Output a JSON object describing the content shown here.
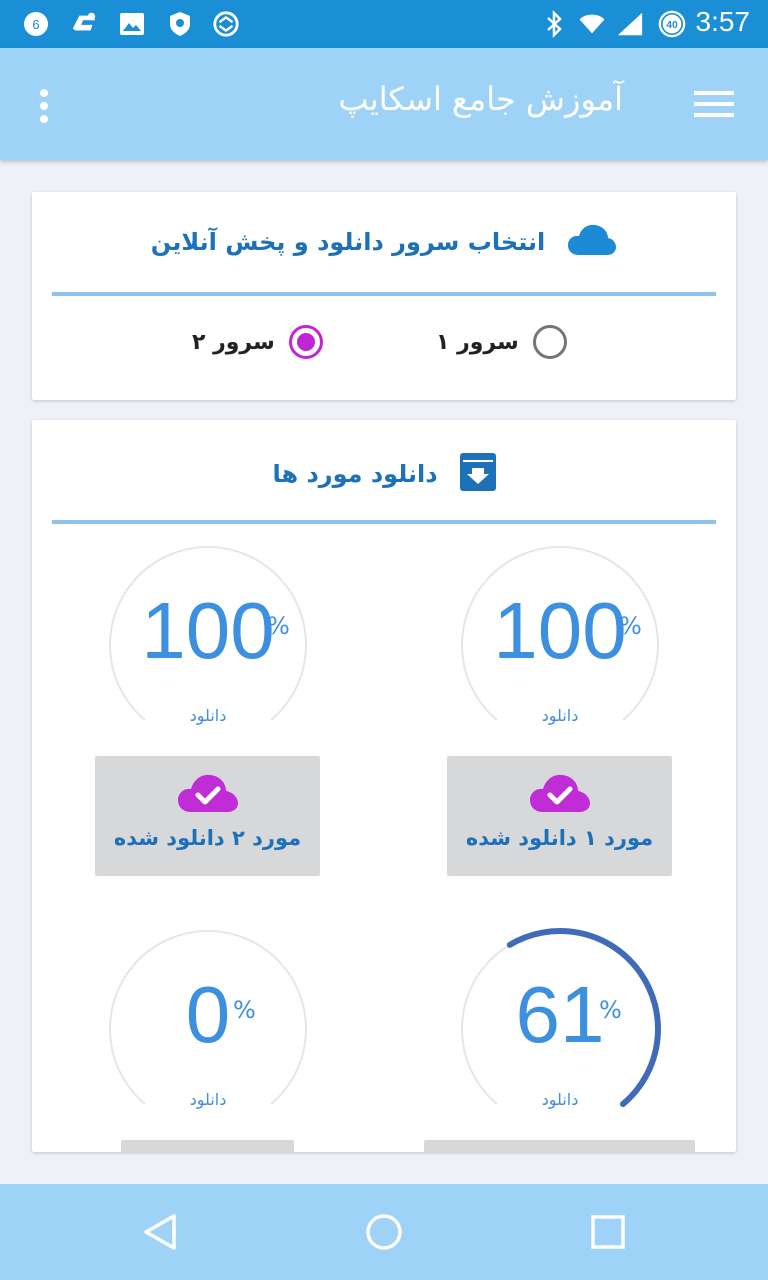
{
  "status_bar": {
    "time": "3:57",
    "notification_count": "6",
    "signal_badge": "40",
    "icons": [
      "notification-count-icon",
      "chat-app-icon",
      "gallery-icon",
      "vpn-shield-icon",
      "sync-app-icon",
      "bluetooth-icon",
      "wifi-icon",
      "cell-signal-icon",
      "data-saver-icon"
    ]
  },
  "app_bar": {
    "title": "آموزش جامع اسکایپ",
    "icons": [
      "more-vert-icon",
      "menu-icon"
    ]
  },
  "server_card": {
    "title": "انتخاب سرور دانلود و پخش آنلاین",
    "icon": "cloud-icon",
    "options": [
      {
        "label": "سرور ۱",
        "selected": false
      },
      {
        "label": "سرور ۲",
        "selected": true
      }
    ],
    "accent_color": "#c026d3"
  },
  "downloads_card": {
    "title": "دانلود مورد ها",
    "icon": "download-box-icon",
    "items": [
      {
        "percent": "100",
        "progress": 100,
        "pct_sign": "%",
        "caption": "دانلود",
        "status": "مورد ۱ دانلود شده"
      },
      {
        "percent": "100",
        "progress": 100,
        "pct_sign": "%",
        "caption": "دانلود",
        "status": "مورد ۲ دانلود شده"
      },
      {
        "percent": "61",
        "progress": 61,
        "pct_sign": "%",
        "caption": "دانلود"
      },
      {
        "percent": "0",
        "progress": 0,
        "pct_sign": "%",
        "caption": "دانلود"
      }
    ],
    "gauge_color": "#3f6bb8",
    "status_icon": "cloud-check-icon",
    "status_icon_color": "#c02cd6"
  },
  "nav_bar": {
    "icons": [
      "back-icon",
      "home-icon",
      "recents-icon"
    ]
  }
}
